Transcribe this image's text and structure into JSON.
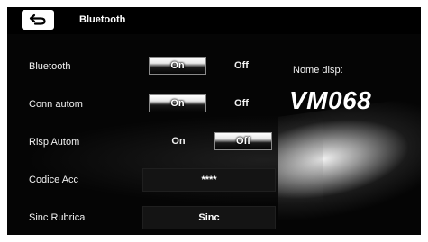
{
  "header": {
    "title": "Bluetooth",
    "back_icon": "back-arrow-icon"
  },
  "rows": [
    {
      "label": "Bluetooth",
      "on_label": "On",
      "off_label": "Off",
      "selected": "On"
    },
    {
      "label": "Conn autom",
      "on_label": "On",
      "off_label": "Off",
      "selected": "On"
    },
    {
      "label": "Risp Autom",
      "on_label": "On",
      "off_label": "Off",
      "selected": "Off"
    }
  ],
  "codice": {
    "label": "Codice Acc",
    "value": "****"
  },
  "sinc": {
    "label": "Sinc Rubrica",
    "button_label": "Sinc"
  },
  "device": {
    "label": "Nome disp:",
    "name": "VM068"
  }
}
